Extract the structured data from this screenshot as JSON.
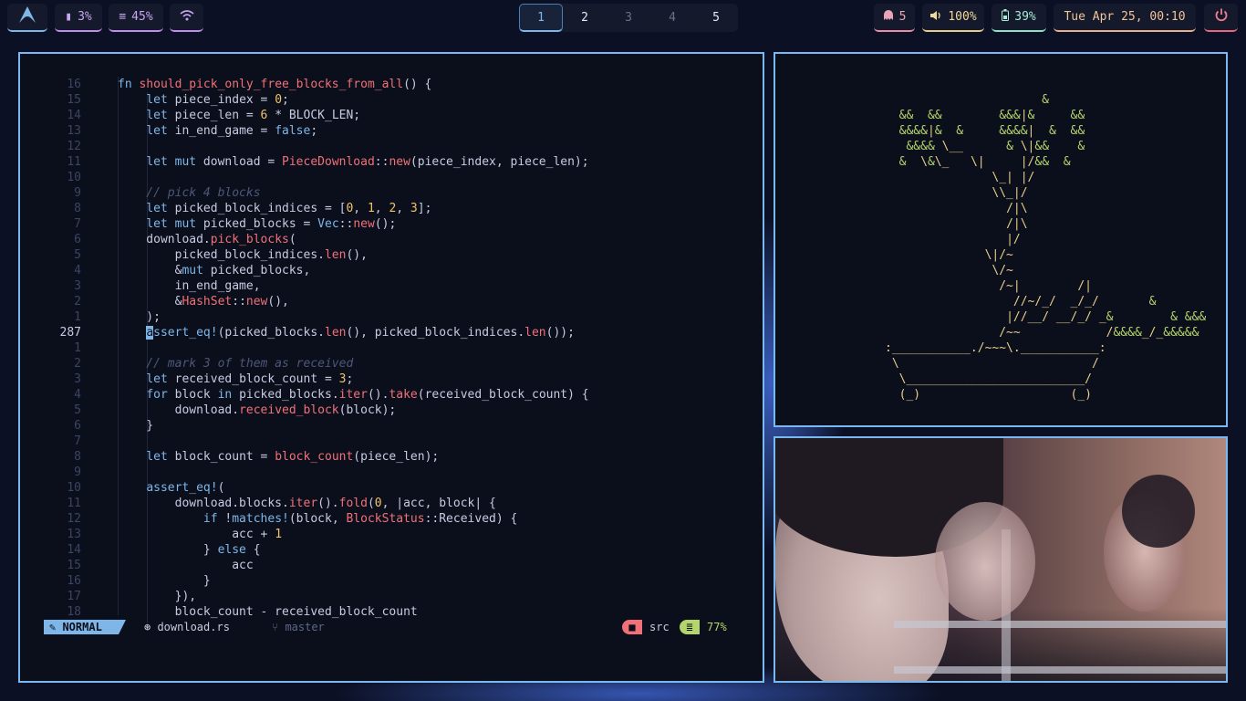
{
  "topbar": {
    "logo_icon": "arch-icon",
    "cpu": "3%",
    "memory": "45%",
    "workspaces": [
      "1",
      "2",
      "3",
      "4",
      "5"
    ],
    "active_workspace": "1",
    "ghost_count": "5",
    "volume": "100%",
    "battery": "39%",
    "clock": "Tue Apr 25, 00:10",
    "colors": {
      "accent": "#7fb6e8",
      "purple": "#c08ee8",
      "pink": "#e88ca8",
      "yellow": "#e8cd88",
      "teal": "#8fe0c8",
      "orange": "#e8b088",
      "red": "#e86880"
    }
  },
  "editor": {
    "lines": [
      {
        "n": "16",
        "t": "fn should_pick_only_free_blocks_from_all() {"
      },
      {
        "n": "15",
        "t": "    let piece_index = 0;"
      },
      {
        "n": "14",
        "t": "    let piece_len = 6 * BLOCK_LEN;"
      },
      {
        "n": "13",
        "t": "    let in_end_game = false;"
      },
      {
        "n": "12",
        "t": ""
      },
      {
        "n": "11",
        "t": "    let mut download = PieceDownload::new(piece_index, piece_len);"
      },
      {
        "n": "10",
        "t": ""
      },
      {
        "n": "9",
        "t": "    // pick 4 blocks"
      },
      {
        "n": "8",
        "t": "    let picked_block_indices = [0, 1, 2, 3];"
      },
      {
        "n": "7",
        "t": "    let mut picked_blocks = Vec::new();"
      },
      {
        "n": "6",
        "t": "    download.pick_blocks("
      },
      {
        "n": "5",
        "t": "        picked_block_indices.len(),"
      },
      {
        "n": "4",
        "t": "        &mut picked_blocks,"
      },
      {
        "n": "3",
        "t": "        in_end_game,"
      },
      {
        "n": "2",
        "t": "        &HashSet::new(),"
      },
      {
        "n": "1",
        "t": "    );"
      },
      {
        "n": "287",
        "t": "    assert_eq!(picked_blocks.len(), picked_block_indices.len());"
      },
      {
        "n": "1",
        "t": ""
      },
      {
        "n": "2",
        "t": "    // mark 3 of them as received"
      },
      {
        "n": "3",
        "t": "    let received_block_count = 3;"
      },
      {
        "n": "4",
        "t": "    for block in picked_blocks.iter().take(received_block_count) {"
      },
      {
        "n": "5",
        "t": "        download.received_block(block);"
      },
      {
        "n": "6",
        "t": "    }"
      },
      {
        "n": "7",
        "t": ""
      },
      {
        "n": "8",
        "t": "    let block_count = block_count(piece_len);"
      },
      {
        "n": "9",
        "t": ""
      },
      {
        "n": "10",
        "t": "    assert_eq!("
      },
      {
        "n": "11",
        "t": "        download.blocks.iter().fold(0, |acc, block| {"
      },
      {
        "n": "12",
        "t": "            if !matches!(block, BlockStatus::Received) {"
      },
      {
        "n": "13",
        "t": "                acc + 1"
      },
      {
        "n": "14",
        "t": "            } else {"
      },
      {
        "n": "15",
        "t": "                acc"
      },
      {
        "n": "16",
        "t": "            }"
      },
      {
        "n": "17",
        "t": "        }),"
      },
      {
        "n": "18",
        "t": "        block_count - received_block_count"
      }
    ],
    "status": {
      "mode": "NORMAL",
      "file": "download.rs",
      "branch": "master",
      "dir": "src",
      "progress": "77%"
    }
  },
  "bonsai": {
    "art": [
      "                      &",
      "  &&  &&        &&&|&     &&",
      "  &&&&|&  &     &&&&|  &  &&",
      "   &&&& \\__      & \\|&&    &",
      "  &  \\&\\_   \\|     |/&&  &",
      "               \\_| |/",
      "               \\\\_|/",
      "                 /|\\",
      "                 /|\\",
      "                 |/",
      "              \\|/~",
      "               \\/~",
      "                /~|        /|",
      "                  //~/_/  _/_/       &",
      "                 |//__/ __/_/ _&        & &&&",
      "                /~~            /&&&&_/_&&&&&",
      ":___________./~~~\\.___________:",
      " \\                           /",
      "  \\_________________________/",
      "  (_)                     (_)"
    ]
  }
}
